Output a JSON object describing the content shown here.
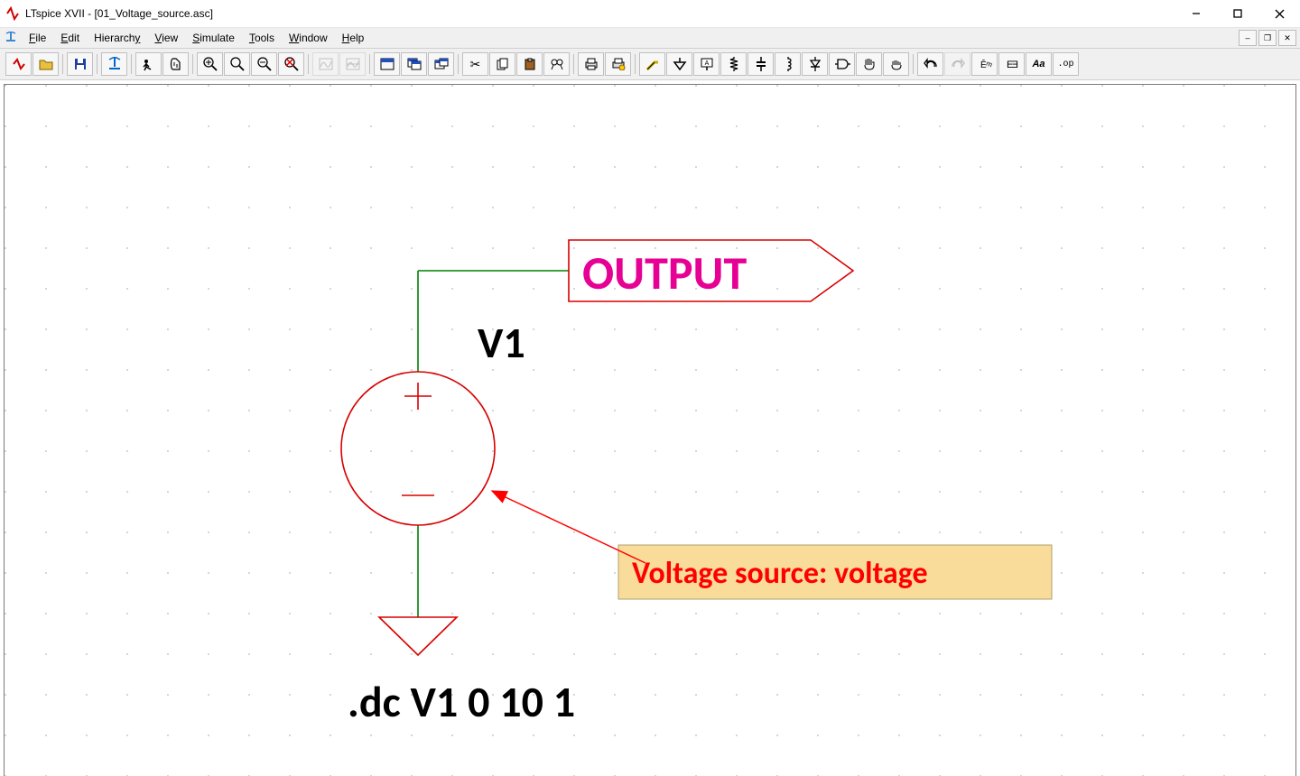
{
  "window": {
    "title": "LTspice XVII - [01_Voltage_source.asc]"
  },
  "menus": {
    "file": "File",
    "edit": "Edit",
    "hierarchy": "Hierarchy",
    "view": "View",
    "simulate": "Simulate",
    "tools": "Tools",
    "window": "Window",
    "help": "Help"
  },
  "toolbar_names": {
    "n0": "new-schematic",
    "n1": "open",
    "n2": "save",
    "n3": "schematic-tree",
    "n4": "run",
    "n5": "pan",
    "n6": "zoom-in",
    "n7": "zoom-out",
    "n8": "zoom-area",
    "n9": "zoom-fit",
    "n10": "autorange",
    "n11": "tile",
    "n12": "window-horz",
    "n13": "window-vert",
    "n14": "window-close",
    "n15": "cut",
    "n16": "copy",
    "n17": "paste",
    "n18": "find",
    "n19": "print",
    "n20": "print-setup",
    "n21": "wire",
    "n22": "ground",
    "n23": "net-label",
    "n24": "resistor",
    "n25": "capacitor",
    "n26": "inductor",
    "n27": "diode",
    "n28": "component",
    "n29": "move",
    "n30": "drag",
    "n31": "undo",
    "n32": "redo",
    "n33": "rotate",
    "n34": "mirror",
    "n35": "text",
    "n36": "spice-directive"
  },
  "schematic": {
    "net_label": "OUTPUT",
    "component_name": "V1",
    "directive": ".dc V1 0 10 1",
    "callout": "Voltage source: voltage"
  }
}
